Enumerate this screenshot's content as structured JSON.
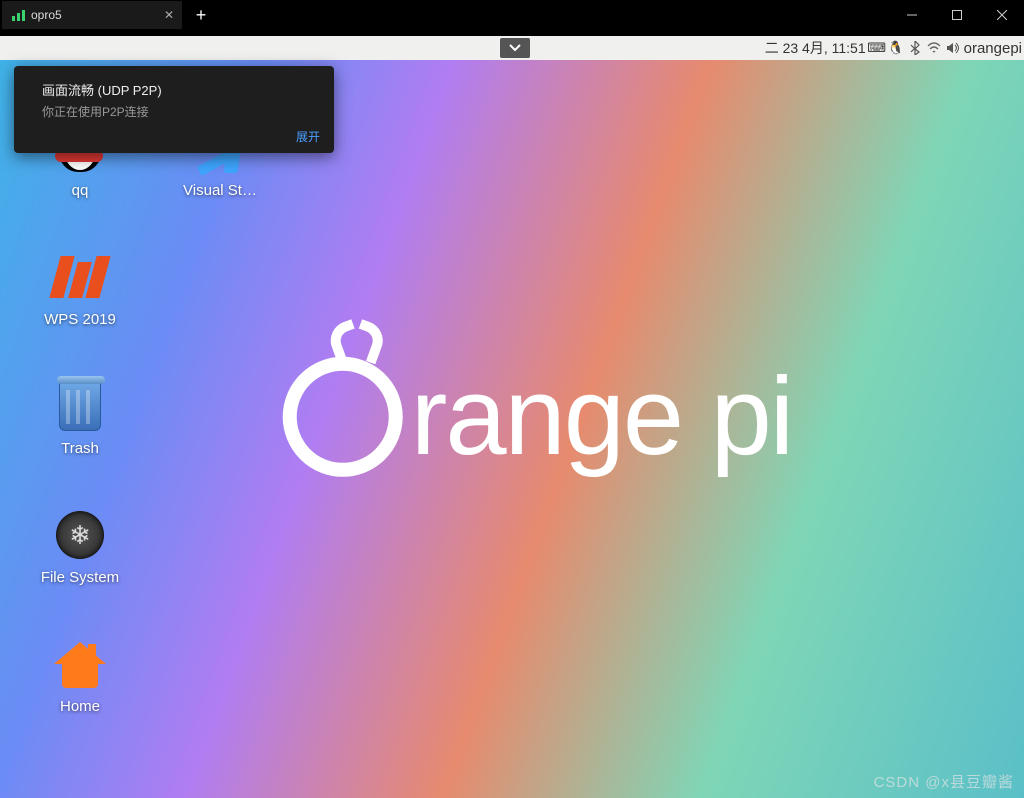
{
  "titlebar": {
    "tab_title": "opro5"
  },
  "panel": {
    "date": "二 23 4月, 11:51",
    "hostname": "orangepi"
  },
  "notification": {
    "title": "画面流畅 (UDP P2P)",
    "subtitle": "你正在使用P2P连接",
    "expand": "展开"
  },
  "desktop_icons": {
    "qq": "qq",
    "wps": "WPS 2019",
    "trash": "Trash",
    "filesystem": "File System",
    "home": "Home",
    "vscode": "Visual St…"
  },
  "brand": "range pi",
  "watermark": "CSDN @x县豆瓣酱"
}
